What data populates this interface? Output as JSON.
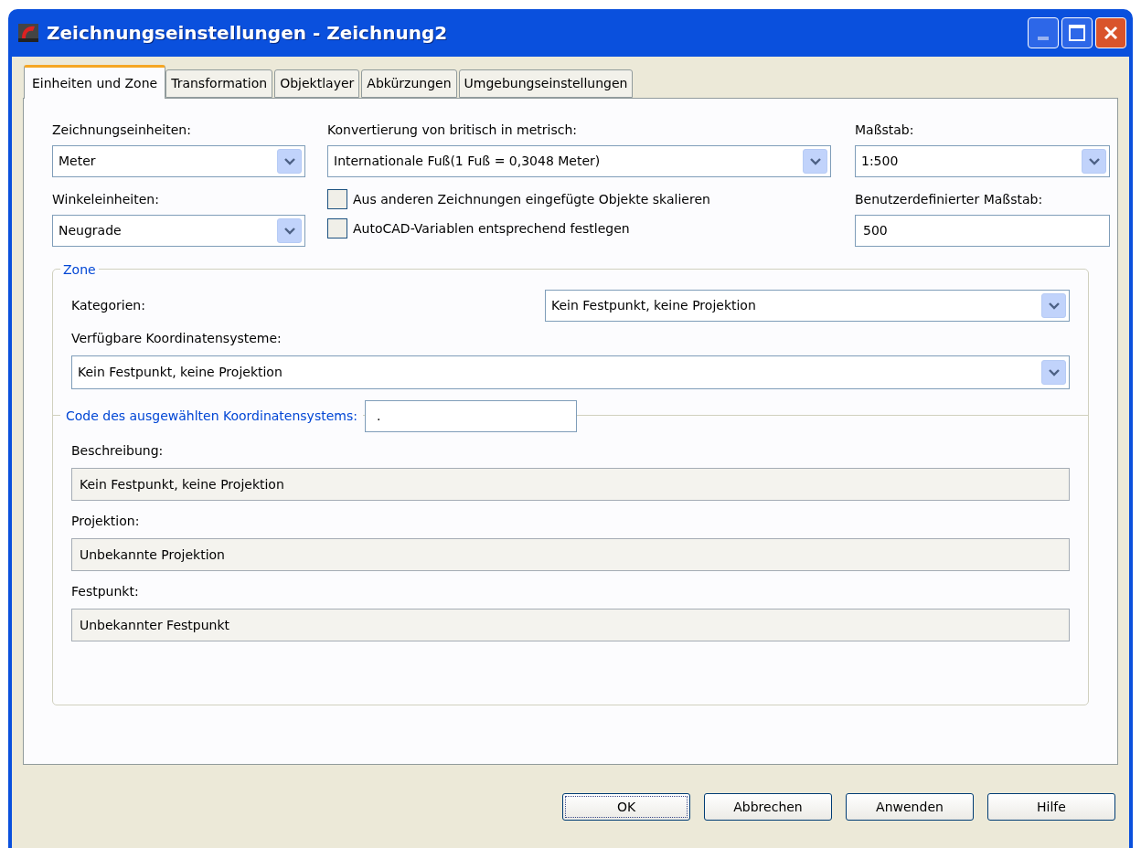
{
  "window": {
    "title": "Zeichnungseinstellungen - Zeichnung2"
  },
  "tabs": [
    {
      "label": "Einheiten und Zone",
      "selected": true
    },
    {
      "label": "Transformation",
      "selected": false
    },
    {
      "label": "Objektlayer",
      "selected": false
    },
    {
      "label": "Abkürzungen",
      "selected": false
    },
    {
      "label": "Umgebungseinstellungen",
      "selected": false
    }
  ],
  "units": {
    "drawing_units": {
      "label": "Zeichnungseinheiten:",
      "value": "Meter"
    },
    "conversion": {
      "label": "Konvertierung von britisch in metrisch:",
      "value": "Internationale Fuß(1 Fuß = 0,3048 Meter)"
    },
    "scale": {
      "label": "Maßstab:",
      "value": "1:500"
    },
    "angle_units": {
      "label": "Winkeleinheiten:",
      "value": "Neugrade"
    },
    "checkboxes": [
      {
        "label": "Aus anderen Zeichnungen eingefügte Objekte skalieren",
        "checked": false
      },
      {
        "label": "AutoCAD-Variablen entsprechend festlegen",
        "checked": false
      }
    ],
    "custom_scale": {
      "label": "Benutzerdefinierter Maßstab:",
      "value": "500"
    }
  },
  "zone": {
    "title": "Zone",
    "categories": {
      "label": "Kategorien:",
      "value": "Kein Festpunkt, keine Projektion"
    },
    "systems": {
      "label": "Verfügbare Koordinatensysteme:",
      "value": "Kein Festpunkt, keine Projektion"
    }
  },
  "code": {
    "label": "Code des ausgewählten Koordinatensystems:",
    "value": ".",
    "fields": [
      {
        "label": "Beschreibung:",
        "value": "Kein Festpunkt, keine Projektion"
      },
      {
        "label": "Projektion:",
        "value": "Unbekannte Projektion"
      },
      {
        "label": "Festpunkt:",
        "value": "Unbekannter Festpunkt"
      }
    ]
  },
  "buttons": [
    {
      "label": "OK",
      "default": true
    },
    {
      "label": "Abbrechen",
      "default": false
    },
    {
      "label": "Anwenden",
      "default": false
    },
    {
      "label": "Hilfe",
      "default": false
    }
  ]
}
